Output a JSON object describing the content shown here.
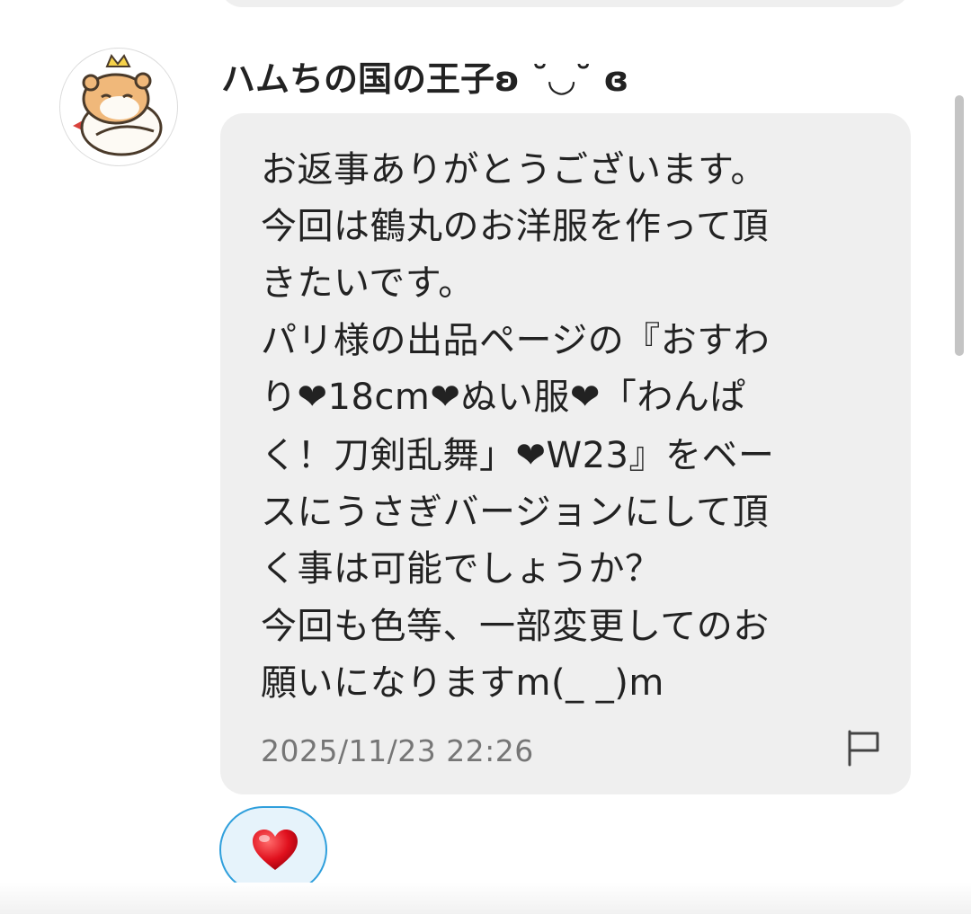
{
  "message": {
    "sender": "ハムちの国の王子ʚ ˘◡˘ ɞ",
    "lines": [
      "お返事ありがとうございます。",
      "今回は鶴丸のお洋服を作って頂",
      "きたいです。",
      "パリ様の出品ページの『おすわ",
      "り❤18cm❤ぬい服❤「わんぱ",
      "く！刀剣乱舞」❤W23』をベー",
      "スにうさぎバージョンにして頂",
      "く事は可能でしょうか？",
      "今回も色等、一部変更してのお",
      "願いになりますm(_ _)m"
    ],
    "timestamp": "2025/11/23 22:26"
  },
  "icons": {
    "avatar": "hamster-prince-avatar",
    "report": "flag-icon",
    "reaction": "heart-icon"
  },
  "colors": {
    "bubble": "#efefef",
    "text": "#222222",
    "timestamp": "#767676",
    "reaction_border": "#2f9fdc",
    "reaction_bg": "#e6f3fb",
    "heart": "#e0101d"
  }
}
